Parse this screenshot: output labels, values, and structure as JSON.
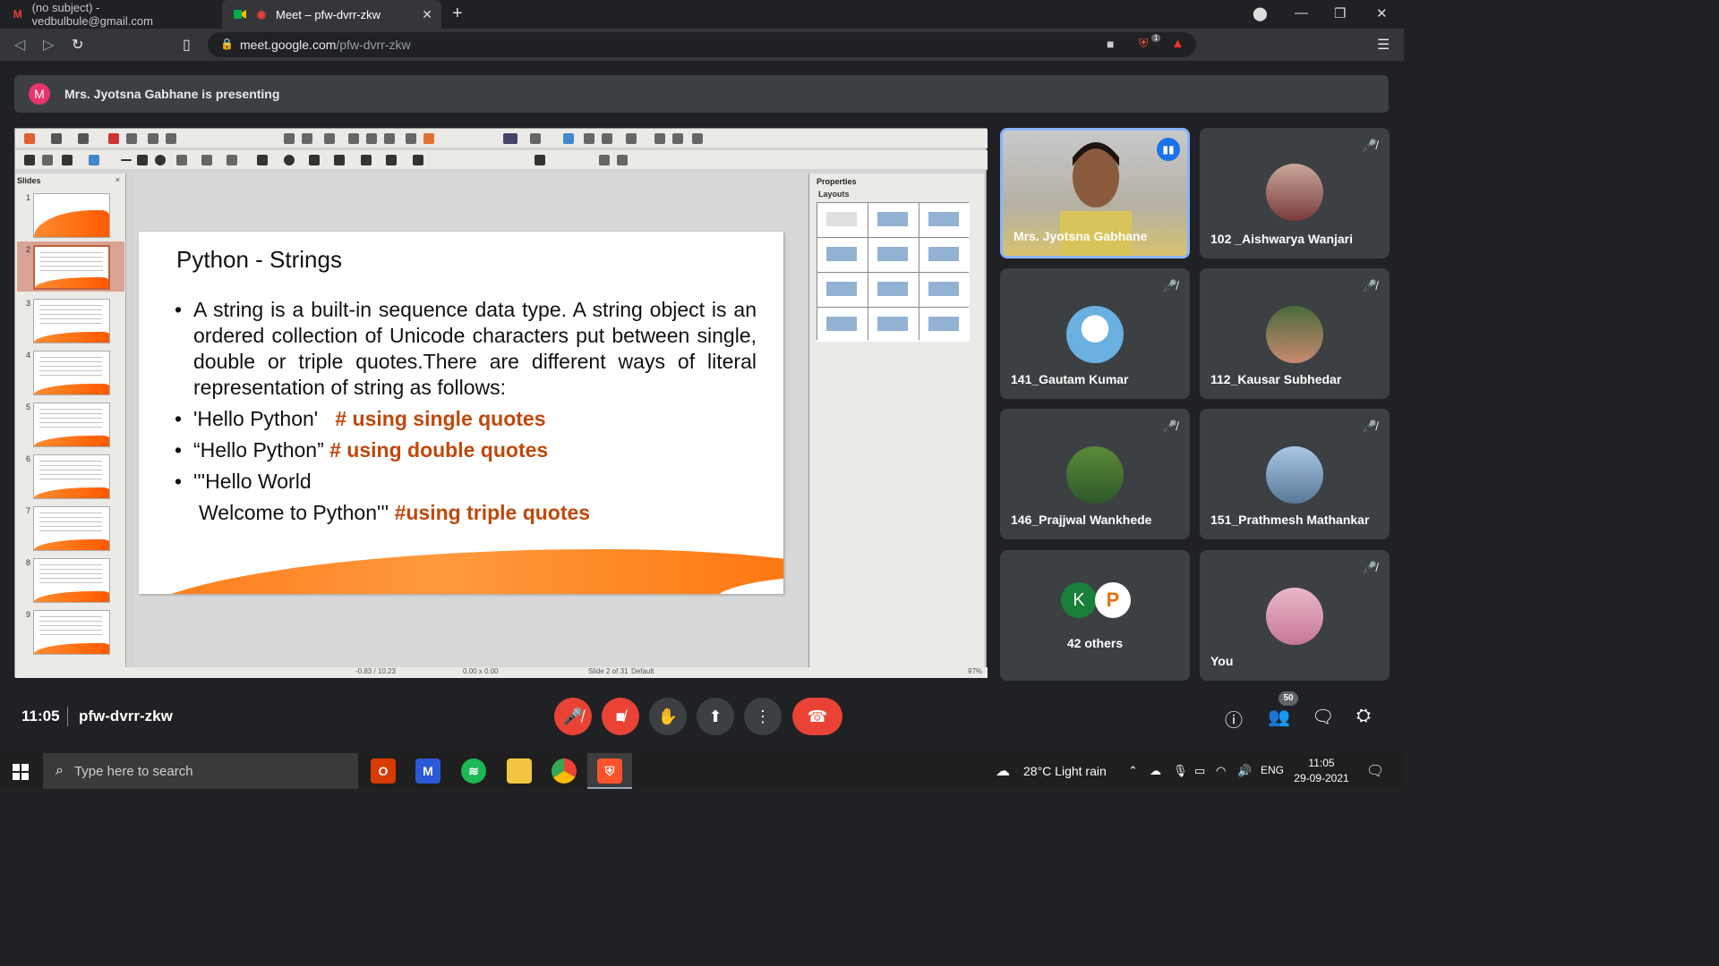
{
  "browser": {
    "tabs": [
      {
        "title": "(no subject) - vedbulbule@gmail.com",
        "icon": "gmail-icon"
      },
      {
        "title": "Meet – pfw-dvrr-zkw",
        "icon": "meet-icon"
      }
    ],
    "url_host": "meet.google.com",
    "url_path": "/pfw-dvrr-zkw",
    "shield_badge": "1"
  },
  "banner": {
    "avatar_letter": "M",
    "text": "Mrs. Jyotsna Gabhane is presenting"
  },
  "impress": {
    "slides_header": "Slides",
    "properties_header": "Properties",
    "layouts_header": "Layouts",
    "thumb_numbers": [
      "1",
      "2",
      "3",
      "4",
      "5",
      "6",
      "7",
      "8",
      "9"
    ],
    "status": {
      "position": "-0.83 / 10.23",
      "size": "0.00 x 0.00",
      "slide": "Slide 2 of 31",
      "master": "Default",
      "zoom": "97%"
    }
  },
  "slide": {
    "title": "Python - Strings",
    "para": "A string is a built-in sequence data type. A string object is an ordered collection of Unicode characters put between single, double or triple quotes.There are different ways of literal representation of string as follows:",
    "b1_code": "'Hello Python'",
    "b1_comment": "# using single quotes",
    "b2_code": "“Hello Python”",
    "b2_comment": "# using double quotes",
    "b3_code": "'''Hello World",
    "b3_line2": "Welcome to Python'''",
    "b3_comment": "#using triple quotes"
  },
  "participants": [
    {
      "name": "Mrs. Jyotsna Gabhane",
      "muted": false
    },
    {
      "name": "102 _Aishwarya Wanjari",
      "muted": true
    },
    {
      "name": "141_Gautam Kumar",
      "muted": true
    },
    {
      "name": "112_Kausar Subhedar",
      "muted": true
    },
    {
      "name": "146_Prajjwal Wankhede",
      "muted": true
    },
    {
      "name": "151_Prathmesh Mathankar",
      "muted": true
    },
    {
      "name": "42 others",
      "letters": [
        "K",
        "P"
      ]
    },
    {
      "name": "You",
      "muted": true
    }
  ],
  "meeting": {
    "time": "11:05",
    "code": "pfw-dvrr-zkw",
    "people_count": "50"
  },
  "taskbar": {
    "search_placeholder": "Type here to search",
    "weather": "28°C  Light rain",
    "lang": "ENG",
    "time": "11:05",
    "date": "29-09-2021"
  },
  "colors": {
    "accent_blue": "#8ab4f8",
    "end_call_red": "#ea4335",
    "slide_orange": "#c0480c"
  }
}
